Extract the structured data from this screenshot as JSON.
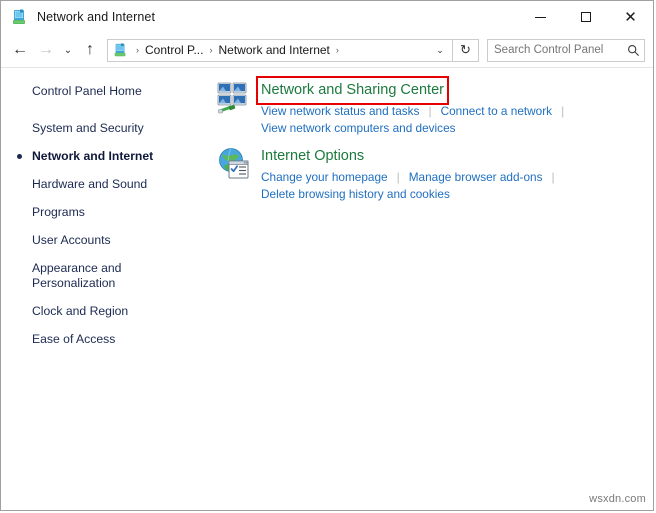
{
  "window": {
    "title": "Network and Internet",
    "title_icon": "control-panel-icon",
    "controls": {
      "minimize": "–",
      "maximize": "□",
      "close": "✕"
    }
  },
  "navbar": {
    "back": "←",
    "forward": "→",
    "recent_dropdown": "⌄",
    "up": "↑",
    "breadcrumb": {
      "icon": "control-panel-icon",
      "items": [
        "Control P...",
        "Network and Internet"
      ],
      "separator": "›",
      "trailing_separator": "›"
    },
    "address_dropdown": "⌄",
    "refresh": "↻",
    "search": {
      "placeholder": "Search Control Panel",
      "value": "",
      "icon": "search-icon"
    }
  },
  "sidebar": {
    "items": [
      {
        "label": "Control Panel Home",
        "current": false
      },
      {
        "label": "System and Security",
        "current": false
      },
      {
        "label": "Network and Internet",
        "current": true
      },
      {
        "label": "Hardware and Sound",
        "current": false
      },
      {
        "label": "Programs",
        "current": false
      },
      {
        "label": "User Accounts",
        "current": false
      },
      {
        "label": "Appearance and Personalization",
        "current": false
      },
      {
        "label": "Clock and Region",
        "current": false
      },
      {
        "label": "Ease of Access",
        "current": false
      }
    ]
  },
  "main": {
    "categories": [
      {
        "icon": "network-sharing-center-icon",
        "title": "Network and Sharing Center",
        "highlighted": true,
        "row1": [
          "View network status and tasks",
          "Connect to a network"
        ],
        "row1_trailing_pipe": true,
        "row2": [
          "View network computers and devices"
        ]
      },
      {
        "icon": "internet-options-icon",
        "title": "Internet Options",
        "highlighted": false,
        "row1": [
          "Change your homepage",
          "Manage browser add-ons"
        ],
        "row1_trailing_pipe": true,
        "row2": [
          "Delete browsing history and cookies"
        ]
      }
    ]
  },
  "watermark": "wsxdn.com",
  "colors": {
    "category_title": "#1d7a3e",
    "link": "#1f6fc0",
    "highlight_border": "#e60000",
    "sidebar_text": "#1c2a52",
    "separator": "#bdbdbd"
  }
}
